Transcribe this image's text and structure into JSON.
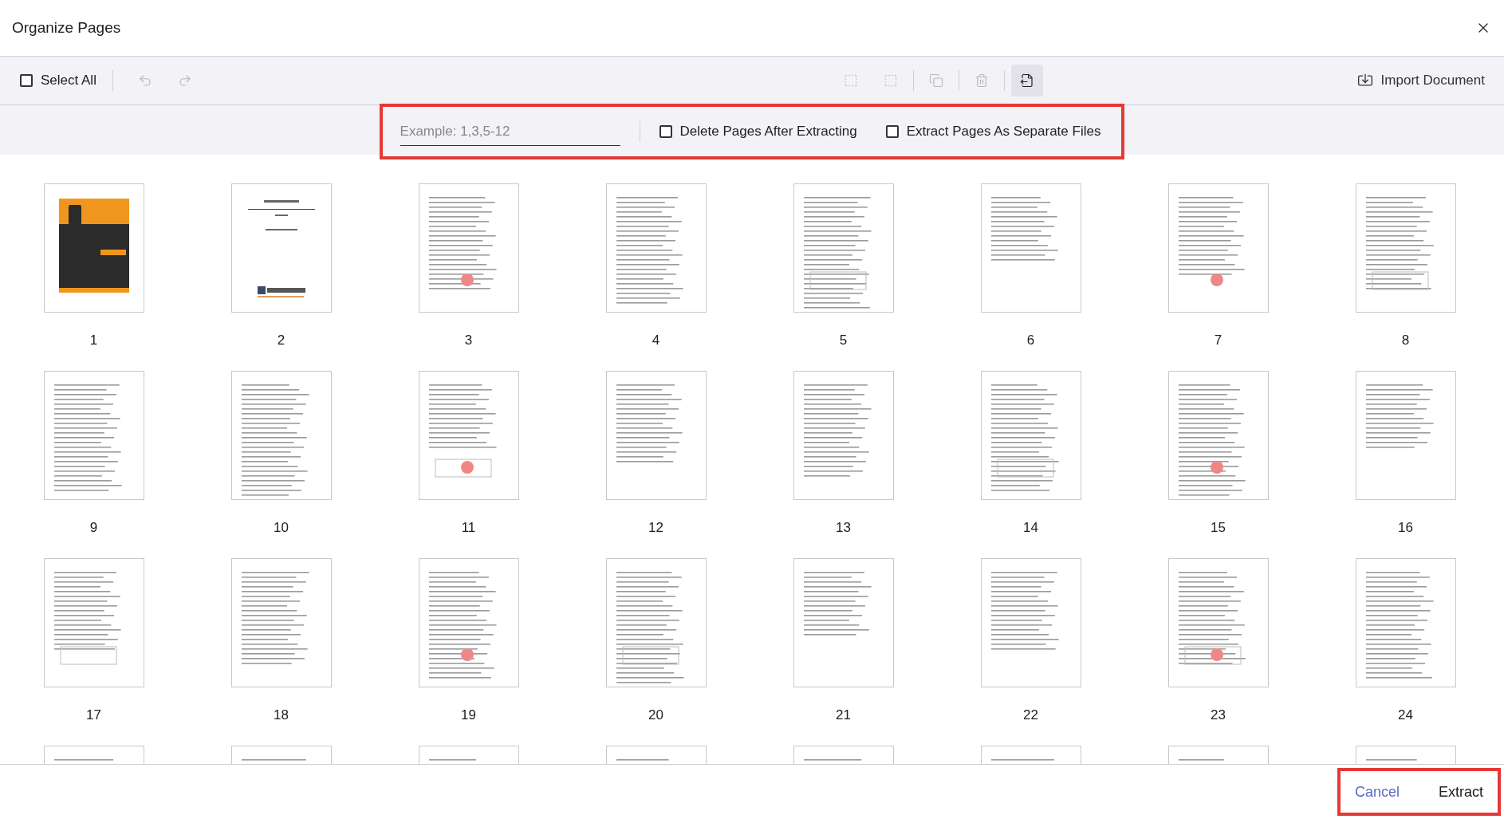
{
  "dialog": {
    "title": "Organize Pages"
  },
  "toolbar": {
    "select_all": {
      "label": "Select All",
      "checked": false
    },
    "tools": [
      {
        "kind": "undo",
        "disabled": true,
        "selected": false
      },
      {
        "kind": "redo",
        "disabled": true,
        "selected": false
      },
      {
        "kind": "insert_before",
        "disabled": true,
        "selected": false
      },
      {
        "kind": "insert_after",
        "disabled": true,
        "selected": false
      },
      {
        "kind": "copy",
        "disabled": true,
        "selected": false
      },
      {
        "kind": "delete",
        "disabled": true,
        "selected": false
      },
      {
        "kind": "extract",
        "disabled": false,
        "selected": true
      }
    ],
    "import": {
      "label": "Import Document"
    }
  },
  "extract_bar": {
    "highlighted": true,
    "placeholder": "Example: 1,3,5-12",
    "options": [
      {
        "label": "Delete Pages After Extracting",
        "checked": false
      },
      {
        "label": "Extract Pages As Separate Files",
        "checked": false
      }
    ]
  },
  "pages": [
    {
      "kind": "cover",
      "number": "1"
    },
    {
      "kind": "title",
      "number": "2"
    },
    {
      "kind": "text",
      "number": "3"
    },
    {
      "kind": "text",
      "number": "4"
    },
    {
      "kind": "text",
      "number": "5"
    },
    {
      "kind": "text",
      "number": "6"
    },
    {
      "kind": "text",
      "number": "7"
    },
    {
      "kind": "text",
      "number": "8"
    },
    {
      "kind": "text",
      "number": "9"
    },
    {
      "kind": "text",
      "number": "10"
    },
    {
      "kind": "text",
      "number": "11"
    },
    {
      "kind": "text",
      "number": "12"
    },
    {
      "kind": "text",
      "number": "13"
    },
    {
      "kind": "text",
      "number": "14"
    },
    {
      "kind": "text",
      "number": "15"
    },
    {
      "kind": "text",
      "number": "16"
    },
    {
      "kind": "text",
      "number": "17"
    },
    {
      "kind": "text",
      "number": "18"
    },
    {
      "kind": "text",
      "number": "19"
    },
    {
      "kind": "text",
      "number": "20"
    },
    {
      "kind": "text",
      "number": "21"
    },
    {
      "kind": "text",
      "number": "22"
    },
    {
      "kind": "text",
      "number": "23"
    },
    {
      "kind": "text",
      "number": "24"
    },
    {
      "kind": "text"
    },
    {
      "kind": "text"
    },
    {
      "kind": "text"
    },
    {
      "kind": "text"
    },
    {
      "kind": "text"
    },
    {
      "kind": "text"
    },
    {
      "kind": "text"
    },
    {
      "kind": "text"
    }
  ],
  "footer": {
    "highlighted": true,
    "buttons": [
      {
        "label": "Cancel",
        "kind": "secondary"
      },
      {
        "label": "Extract",
        "kind": "primary"
      }
    ]
  }
}
